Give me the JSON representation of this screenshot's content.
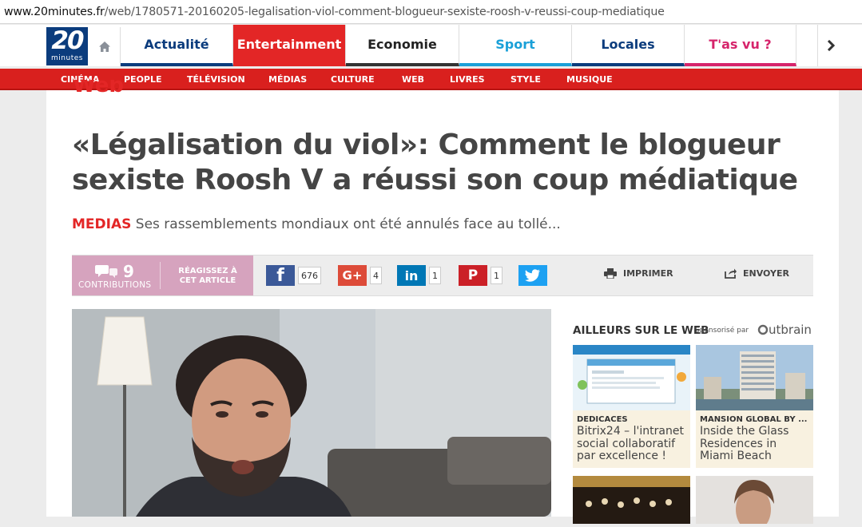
{
  "browser": {
    "url_host": "www.20minutes.fr",
    "url_path": "/web/1780571-20160205-legalisation-viol-comment-blogueur-sexiste-roosh-v-reussi-coup-mediatique"
  },
  "logo": {
    "big": "20",
    "small": "minutes"
  },
  "nav": {
    "home_icon": "home-icon",
    "tabs": [
      "Actualité",
      "Entertainment",
      "Economie",
      "Sport",
      "Locales",
      "T'as vu ?"
    ],
    "next_icon": "chevron-right-icon"
  },
  "subnav": {
    "items": [
      "CINÉMA",
      "PEOPLE",
      "TÉLÉVISION",
      "MÉDIAS",
      "CULTURE",
      "WEB",
      "LIVRES",
      "STYLE",
      "MUSIQUE"
    ]
  },
  "article": {
    "rubrique": "Web",
    "headline_line1": "«Légalisation du viol»: Comment le blogueur",
    "headline_line2": "sexiste Roosh V a réussi son coup médiatique",
    "lead_keyword": "MEDIAS",
    "lead_text": " Ses rassemblements mondiaux ont été annulés face au tollé..."
  },
  "sharebar": {
    "contrib_count": "9",
    "contrib_label": "CONTRIBUTIONS",
    "react_line1": "RÉAGISSEZ À",
    "react_line2": "CET ARTICLE",
    "facebook_count": "676",
    "googleplus_count": "4",
    "linkedin_count": "1",
    "pinterest_count": "1",
    "print_label": "IMPRIMER",
    "send_label": "ENVOYER"
  },
  "sidebar": {
    "heading": "AILLEURS SUR LE WEB",
    "sponsored": "Sponsorisé par",
    "brand": "utbrain",
    "cards": [
      {
        "source": "DEDICACES",
        "title": "Bitrix24 – l'intranet social collaboratif par excellence !"
      },
      {
        "source": "MANSION GLOBAL BY ...",
        "title": "Inside the Glass Residences in Miami Beach"
      }
    ]
  },
  "colors": {
    "brand_blue": "#0b3c7d",
    "entertainment_red": "#e32626",
    "sport_blue": "#1aa0d8",
    "tasvu_pink": "#d6246b",
    "facebook": "#3b5998",
    "googleplus": "#dd4b39",
    "linkedin": "#0077b5",
    "pinterest": "#cb2027",
    "twitter": "#1da1f2"
  }
}
